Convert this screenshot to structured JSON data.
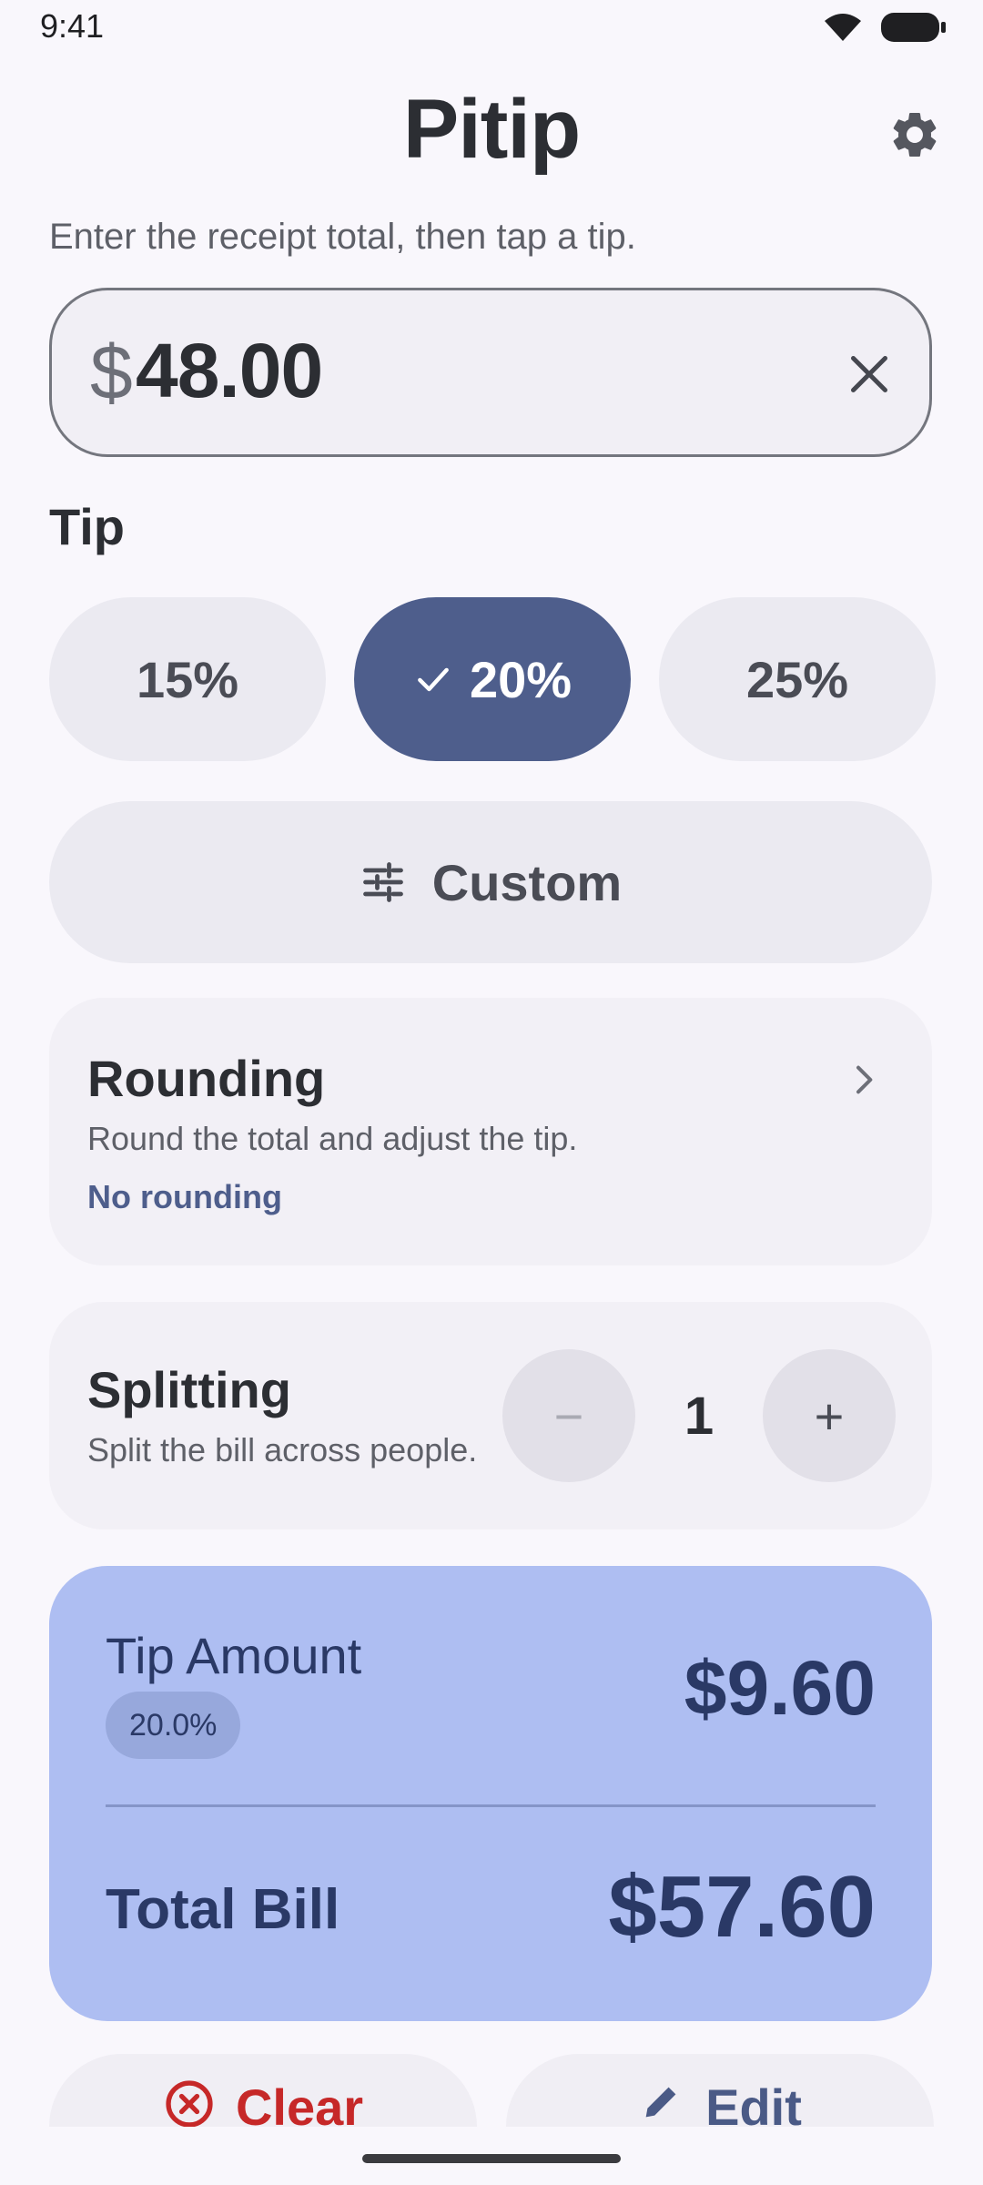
{
  "status": {
    "time": "9:41"
  },
  "app": {
    "title": "Pitip"
  },
  "instruction": "Enter the receipt total, then tap a tip.",
  "amount": {
    "currency": "$",
    "value": "48.00"
  },
  "tip": {
    "heading": "Tip",
    "options": [
      {
        "label": "15%",
        "selected": false
      },
      {
        "label": "20%",
        "selected": true
      },
      {
        "label": "25%",
        "selected": false
      }
    ],
    "custom_label": "Custom"
  },
  "rounding": {
    "title": "Rounding",
    "subtitle": "Round the total and adjust the tip.",
    "value": "No rounding"
  },
  "splitting": {
    "title": "Splitting",
    "subtitle": "Split the bill across people.",
    "count": "1",
    "minus": "−",
    "plus": "+"
  },
  "result": {
    "tip_label": "Tip Amount",
    "tip_percent": "20.0%",
    "tip_value": "$9.60",
    "total_label": "Total Bill",
    "total_value": "$57.60"
  },
  "actions": {
    "clear_label": "Clear",
    "edit_label": "Edit"
  },
  "colors": {
    "accent": "#4E5E8C",
    "result_bg": "#AEBEF2",
    "danger": "#C62828"
  }
}
